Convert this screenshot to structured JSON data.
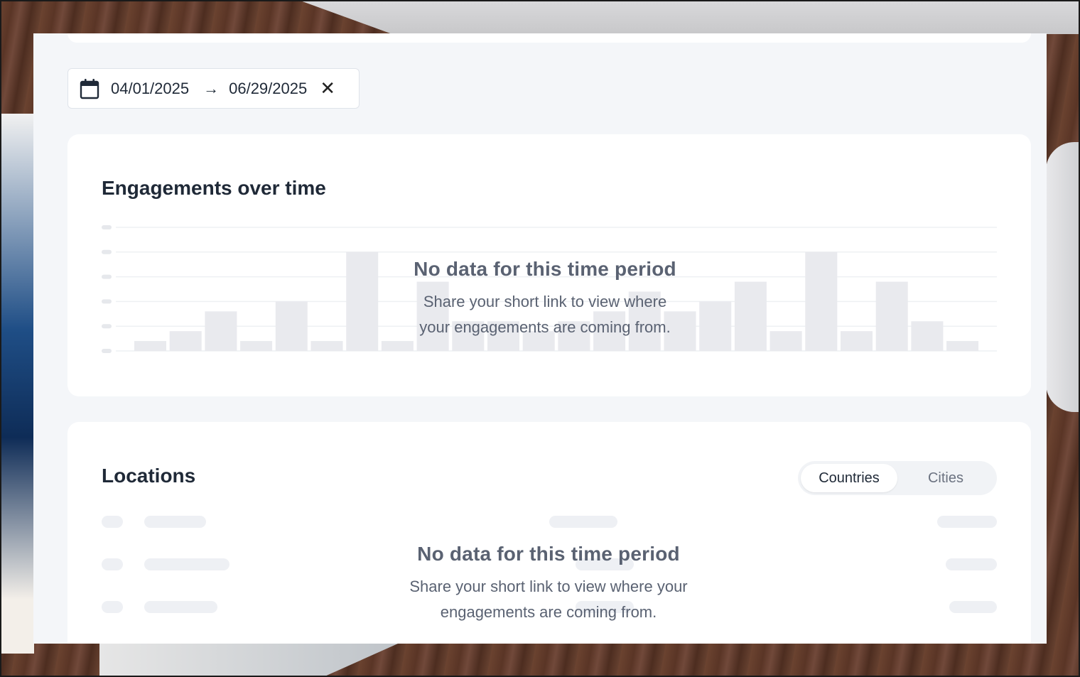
{
  "date_range": {
    "start": "04/01/2025",
    "end": "06/29/2025",
    "arrow": "→",
    "clear": "✕"
  },
  "engagements": {
    "title": "Engagements over time",
    "empty_title": "No data for this time period",
    "empty_message_line1": "Share your short link to view where",
    "empty_message_line2": "your engagements are coming from.",
    "placeholder_bar_levels": [
      1,
      2,
      4,
      1,
      5,
      1,
      10,
      1,
      7,
      3,
      3,
      2,
      3,
      4,
      6,
      4,
      5,
      7,
      2,
      10,
      2,
      7,
      3,
      1
    ]
  },
  "locations": {
    "title": "Locations",
    "tabs": [
      {
        "label": "Countries",
        "active": true
      },
      {
        "label": "Cities",
        "active": false
      }
    ],
    "empty_title": "No data for this time period",
    "empty_message_line1": "Share your short link to view where your",
    "empty_message_line2": "engagements are coming from."
  },
  "colors": {
    "panel_bg": "#f4f6f9",
    "card_bg": "#ffffff",
    "placeholder_bar": "#e9eaee",
    "text_primary": "#1f2937",
    "text_muted": "#5a6272"
  }
}
